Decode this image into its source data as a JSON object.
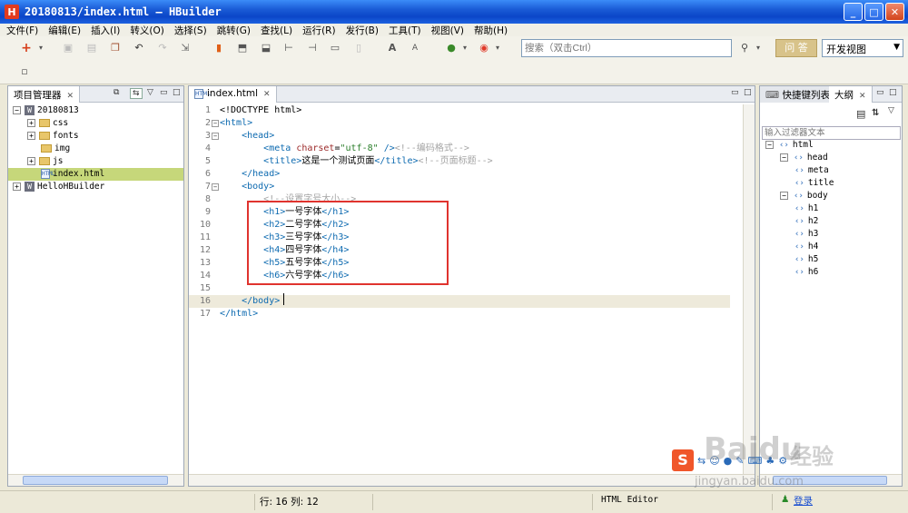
{
  "window": {
    "title": "20180813/index.html — HBuilder",
    "logo": "H",
    "controls": [
      "_",
      "□",
      "✕"
    ]
  },
  "menu": [
    "文件(F)",
    "编辑(E)",
    "插入(I)",
    "转义(O)",
    "选择(S)",
    "跳转(G)",
    "查找(L)",
    "运行(R)",
    "发行(B)",
    "工具(T)",
    "视图(V)",
    "帮助(H)"
  ],
  "toolbar": {
    "search_placeholder": "搜索（双击Ctrl）",
    "ask_label": "问 答",
    "view_select": "开发视图"
  },
  "project_panel": {
    "tab_label": "项目管理器",
    "tree": [
      {
        "label": "20180813",
        "type": "project",
        "expand": "−",
        "indent": 0
      },
      {
        "label": "css",
        "type": "folder",
        "expand": "+",
        "indent": 1
      },
      {
        "label": "fonts",
        "type": "folder",
        "expand": "+",
        "indent": 1
      },
      {
        "label": "img",
        "type": "folder",
        "expand": "",
        "indent": 1
      },
      {
        "label": "js",
        "type": "folder",
        "expand": "+",
        "indent": 1
      },
      {
        "label": "index.html",
        "type": "file",
        "expand": "",
        "indent": 1,
        "selected": true
      },
      {
        "label": "HelloHBuilder",
        "type": "project",
        "expand": "+",
        "indent": 0
      }
    ]
  },
  "editor": {
    "tab_label": "index.html",
    "lines": [
      {
        "n": "1",
        "fold": "",
        "html": "<span class=\"doctype\">&lt;!DOCTYPE html&gt;</span>"
      },
      {
        "n": "2",
        "fold": "−",
        "html": "<span class=\"tag\">&lt;html&gt;</span>"
      },
      {
        "n": "3",
        "fold": "−",
        "html": "    <span class=\"tag\">&lt;head&gt;</span>"
      },
      {
        "n": "4",
        "fold": "",
        "html": "        <span class=\"tag\">&lt;meta</span> <span class=\"attr\">charset</span>=<span class=\"str\">\"utf-8\"</span> <span class=\"tag\">/&gt;</span><span class=\"cmt\">&lt;!--编码格式--&gt;</span>"
      },
      {
        "n": "5",
        "fold": "",
        "html": "        <span class=\"tag\">&lt;title&gt;</span>这是一个测试页面<span class=\"tag\">&lt;/title&gt;</span><span class=\"cmt\">&lt;!--页面标题--&gt;</span>"
      },
      {
        "n": "6",
        "fold": "",
        "html": "    <span class=\"tag\">&lt;/head&gt;</span>"
      },
      {
        "n": "7",
        "fold": "−",
        "html": "    <span class=\"tag\">&lt;body&gt;</span>"
      },
      {
        "n": "8",
        "fold": "",
        "html": "        <span class=\"cmt\">&lt;!--设置字号大小--&gt;</span>"
      },
      {
        "n": "9",
        "fold": "",
        "html": "        <span class=\"tag\">&lt;h1&gt;</span>一号字体<span class=\"tag\">&lt;/h1&gt;</span>"
      },
      {
        "n": "10",
        "fold": "",
        "html": "        <span class=\"tag\">&lt;h2&gt;</span>二号字体<span class=\"tag\">&lt;/h2&gt;</span>"
      },
      {
        "n": "11",
        "fold": "",
        "html": "        <span class=\"tag\">&lt;h3&gt;</span>三号字体<span class=\"tag\">&lt;/h3&gt;</span>"
      },
      {
        "n": "12",
        "fold": "",
        "html": "        <span class=\"tag\">&lt;h4&gt;</span>四号字体<span class=\"tag\">&lt;/h4&gt;</span>"
      },
      {
        "n": "13",
        "fold": "",
        "html": "        <span class=\"tag\">&lt;h5&gt;</span>五号字体<span class=\"tag\">&lt;/h5&gt;</span>"
      },
      {
        "n": "14",
        "fold": "",
        "html": "        <span class=\"tag\">&lt;h6&gt;</span>六号字体<span class=\"tag\">&lt;/h6&gt;</span>"
      },
      {
        "n": "15",
        "fold": "",
        "html": ""
      },
      {
        "n": "16",
        "fold": "",
        "html": "    <span class=\"tag\">&lt;/body&gt;</span>",
        "current": true
      },
      {
        "n": "17",
        "fold": "",
        "html": "<span class=\"tag\">&lt;/html&gt;</span>"
      }
    ]
  },
  "outline_panel": {
    "tab_shortcut": "快捷键列表",
    "tab_outline": "大纲",
    "filter_placeholder": "输入过滤器文本",
    "nodes": [
      {
        "label": "html",
        "expand": "−",
        "indent": 0
      },
      {
        "label": "head",
        "expand": "−",
        "indent": 1
      },
      {
        "label": "meta",
        "expand": "",
        "indent": 2
      },
      {
        "label": "title",
        "expand": "",
        "indent": 2
      },
      {
        "label": "body",
        "expand": "−",
        "indent": 1
      },
      {
        "label": "h1",
        "expand": "",
        "indent": 2
      },
      {
        "label": "h2",
        "expand": "",
        "indent": 2
      },
      {
        "label": "h3",
        "expand": "",
        "indent": 2
      },
      {
        "label": "h4",
        "expand": "",
        "indent": 2
      },
      {
        "label": "h5",
        "expand": "",
        "indent": 2
      },
      {
        "label": "h6",
        "expand": "",
        "indent": 2
      }
    ]
  },
  "status": {
    "position": "行: 16 列: 12",
    "mode": "HTML Editor",
    "login": "登录"
  },
  "watermark": {
    "baidu": "Baidu",
    "jingyan": "经验",
    "url": "jingyan.baidu.com"
  }
}
